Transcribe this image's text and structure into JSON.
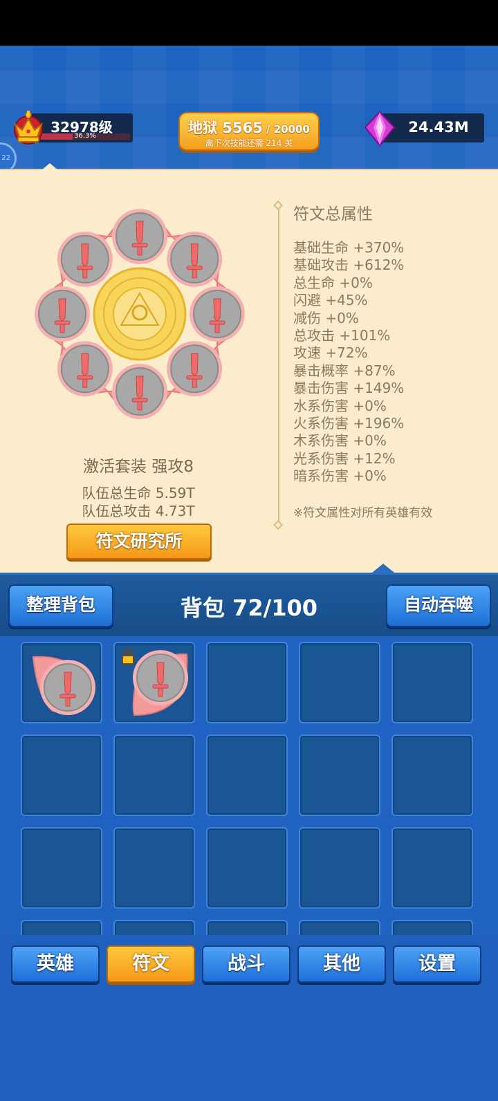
{
  "player": {
    "level_text": "32978级",
    "level_percent_text": "36.3%",
    "level_progress": 0.363
  },
  "stage": {
    "name": "地狱",
    "current": "5565",
    "separator": " / ",
    "max": "20000",
    "subtitle": "离下次技能还需 214 关"
  },
  "currency": {
    "gems_text": "24.43M"
  },
  "side_indicator": "22",
  "runes": {
    "suit_text": "激活套装  强攻8",
    "team_hp": "队伍总生命 5.59T",
    "team_atk": "队伍总攻击 4.73T",
    "research_button": "符文研究所"
  },
  "stats": {
    "title": "符文总属性",
    "items": [
      "基础生命 +370%",
      "基础攻击 +612%",
      "总生命 +0%",
      "闪避 +45%",
      "减伤 +0%",
      "总攻击 +101%",
      "攻速 +72%",
      "暴击概率 +87%",
      "暴击伤害 +149%",
      "水系伤害 +0%",
      "火系伤害 +196%",
      "木系伤害 +0%",
      "光系伤害 +12%",
      "暗系伤害 +0%"
    ],
    "note": "※符文属性对所有英雄有效"
  },
  "bag": {
    "sort_button": "整理背包",
    "title": "背包 72/100",
    "auto_button": "自动吞噬"
  },
  "nav": {
    "tabs": [
      {
        "label": "英雄",
        "active": false
      },
      {
        "label": "符文",
        "active": true
      },
      {
        "label": "战斗",
        "active": false
      },
      {
        "label": "其他",
        "active": false
      },
      {
        "label": "设置",
        "active": false
      }
    ]
  },
  "colors": {
    "petal": "#f59a9a",
    "rune_circle": "#a8a8a8",
    "sword": "#f06a6a",
    "gold": "#f4a01e",
    "parchment": "#fbeccb"
  }
}
